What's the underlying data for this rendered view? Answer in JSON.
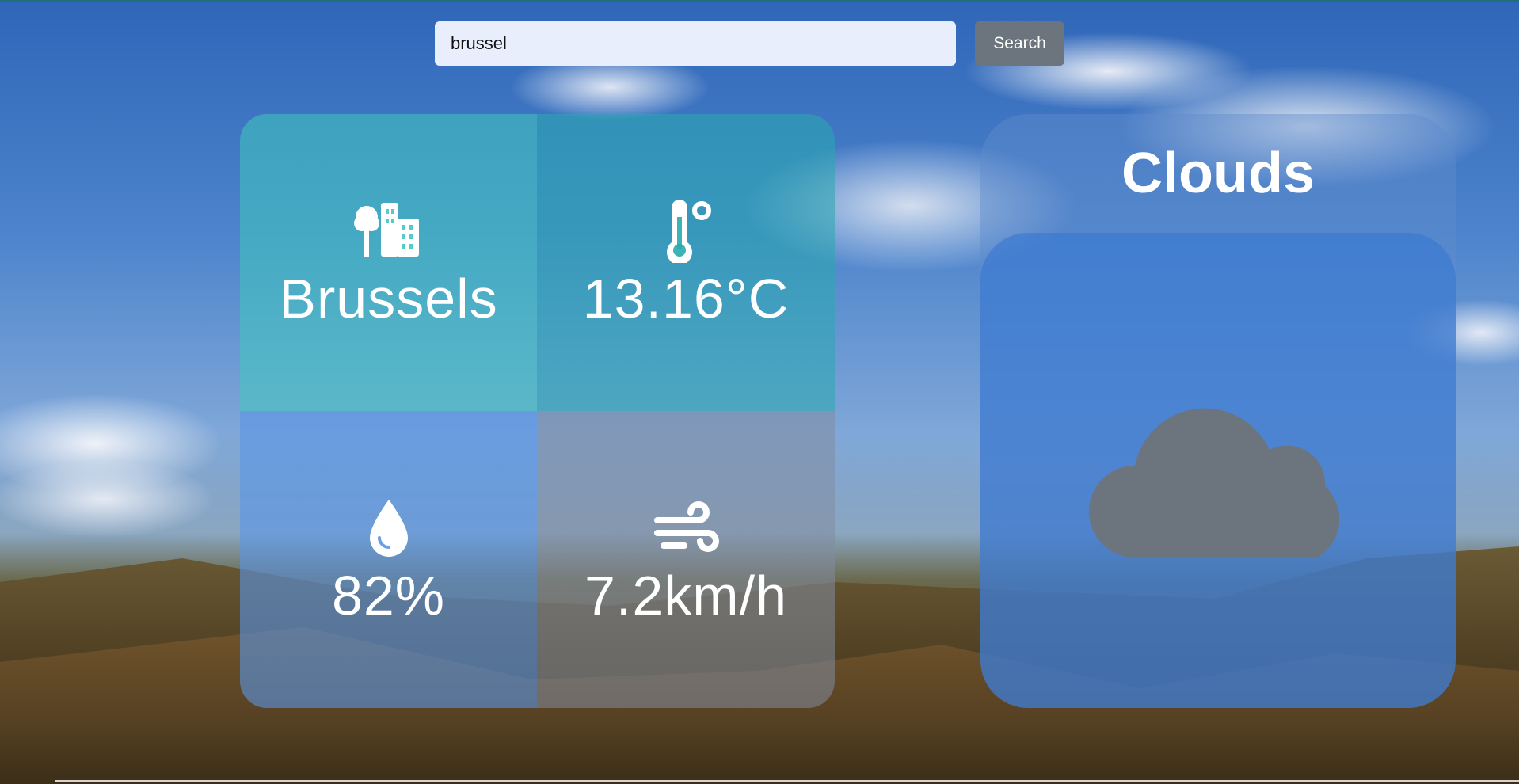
{
  "search": {
    "value": "brussel",
    "button_label": "Search"
  },
  "stats": {
    "city": "Brussels",
    "temperature": "13.16°C",
    "humidity": "82%",
    "wind": "7.2km/h"
  },
  "weather": {
    "condition": "Clouds"
  },
  "colors": {
    "search_button": "#6c757d",
    "search_field": "#e8eefc",
    "cloud_icon": "#6c757d"
  },
  "icons": {
    "city": "city-icon",
    "temperature": "temperature-icon",
    "humidity": "droplet-icon",
    "wind": "wind-icon",
    "weather": "cloud-icon"
  }
}
